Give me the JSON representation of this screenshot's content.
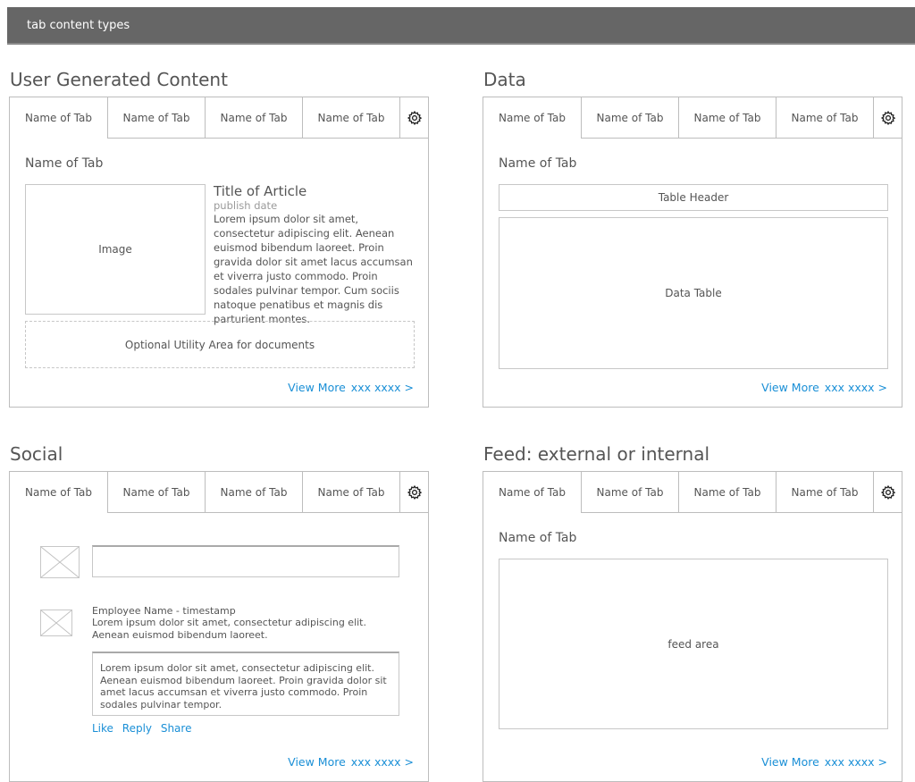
{
  "header": {
    "title": "tab content types"
  },
  "tab_label": "Name of Tab",
  "view_more": {
    "label": "View More",
    "count": "xxx xxxx >"
  },
  "ugc": {
    "title": "User Generated Content",
    "subtitle": "Name of Tab",
    "image_label": "Image",
    "article_title": "Title of Article",
    "publish_date": "publish date",
    "article_body": "Lorem ipsum dolor sit amet, consectetur adipiscing elit. Aenean euismod bibendum laoreet. Proin gravida dolor sit amet lacus accumsan et viverra justo commodo. Proin sodales pulvinar tempor. Cum sociis natoque penatibus et magnis dis parturient montes.",
    "utility_label": "Optional Utility Area for documents"
  },
  "data": {
    "title": "Data",
    "subtitle": "Name of Tab",
    "table_header": "Table Header",
    "table_label": "Data Table"
  },
  "social": {
    "title": "Social",
    "post_header": "Employee Name - timestamp",
    "post_body": "Lorem ipsum dolor sit amet, consectetur adipiscing elit. Aenean euismod bibendum laoreet.",
    "reply_body": "Lorem ipsum dolor sit amet, consectetur adipiscing elit. Aenean euismod bibendum laoreet. Proin gravida dolor sit amet lacus accumsan et viverra justo commodo. Proin sodales pulvinar tempor.",
    "actions": {
      "like": "Like",
      "reply": "Reply",
      "share": "Share"
    }
  },
  "feed": {
    "title": "Feed: external or internal",
    "subtitle": "Name of Tab",
    "feed_label": "feed area"
  },
  "colors": {
    "header_bg": "#666666",
    "link": "#1a8fd6",
    "border": "#bdbdbd"
  },
  "icons": {
    "settings": "gear-icon",
    "avatar": "image-placeholder-icon"
  }
}
